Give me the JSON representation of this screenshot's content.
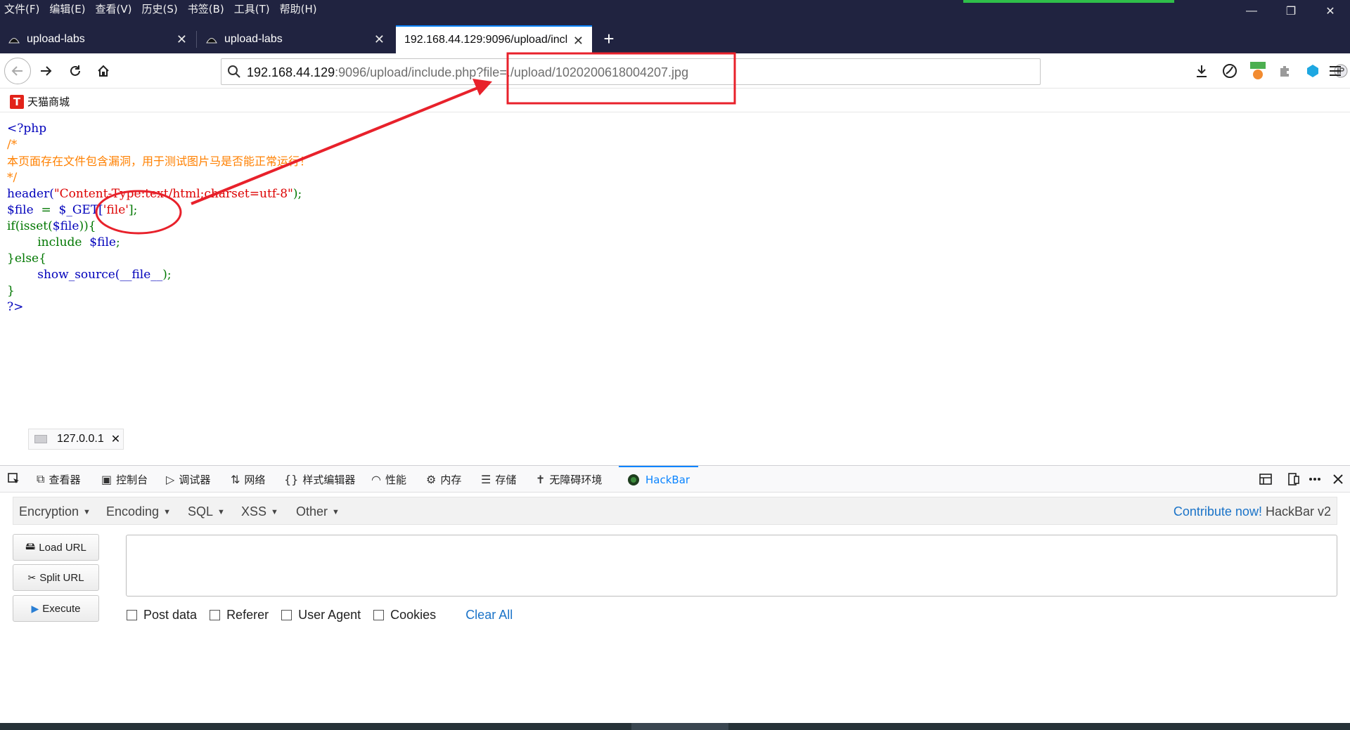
{
  "menu": [
    "文件(F)",
    "编辑(E)",
    "查看(V)",
    "历史(S)",
    "书签(B)",
    "工具(T)",
    "帮助(H)"
  ],
  "window_controls": {
    "minimize": "—",
    "restore": "❐",
    "close": "✕"
  },
  "tabs": [
    {
      "title": "upload-labs"
    },
    {
      "title": "upload-labs"
    },
    {
      "title": "192.168.44.129:9096/upload/incl"
    }
  ],
  "tab_close_glyph": "✕",
  "newtab_glyph": "+",
  "url": {
    "host": "192.168.44.129",
    "rest": ":9096/upload/include.php?file=./upload/1020200618004207.jpg"
  },
  "bookmarks": [
    {
      "icon_letter": "T",
      "label": "天猫商城"
    }
  ],
  "code_lines": {
    "open": "<?php",
    "comment_start": "/*",
    "comment_text": "本页面存在文件包含漏洞，用于测试图片马是否能正常运行！",
    "comment_end": "*/",
    "l1_fn": "header(",
    "l1_str": "\"Content-Type:text/html;charset=utf-8\"",
    "l1_end": ");",
    "l2_var": "$file",
    "l2_eq": "  =  ",
    "l2_get": "$_GET[",
    "l2_key": "'file'",
    "l2_end": "];",
    "l3_if": "if(isset(",
    "l3_var": "$file",
    "l3_end": ")){",
    "l4_include": "include",
    "l4_var": "$file",
    "l4_end": ";",
    "l5_else": "}else{",
    "l6_fn": "show_source(",
    "l6_arg": "__file__",
    "l6_end": ");",
    "l7_close": "}",
    "close": "?>"
  },
  "host_tooltip": {
    "label": "127.0.0.1",
    "close": "✕"
  },
  "devtools": {
    "tabs": [
      "查看器",
      "控制台",
      "调试器",
      "网络",
      "样式编辑器",
      "性能",
      "内存",
      "存储",
      "无障碍环境",
      "HackBar"
    ],
    "active_tab": "HackBar"
  },
  "hackbar": {
    "menus": [
      "Encryption",
      "Encoding",
      "SQL",
      "XSS",
      "Other"
    ],
    "contribute_link": "Contribute now!",
    "contribute_suffix": " HackBar v2",
    "buttons": [
      "Load URL",
      "Split URL",
      "Execute"
    ],
    "textarea_value": "",
    "options": [
      "Post data",
      "Referer",
      "User Agent",
      "Cookies"
    ],
    "clear_all": "Clear All"
  },
  "colors": {
    "titlebar": "#202340",
    "accent": "#0a84ff",
    "annotation_red": "#e8212b",
    "php_blue": "#0000bb",
    "php_orange": "#ff8000",
    "php_red": "#dd0000",
    "php_green": "#007700"
  }
}
